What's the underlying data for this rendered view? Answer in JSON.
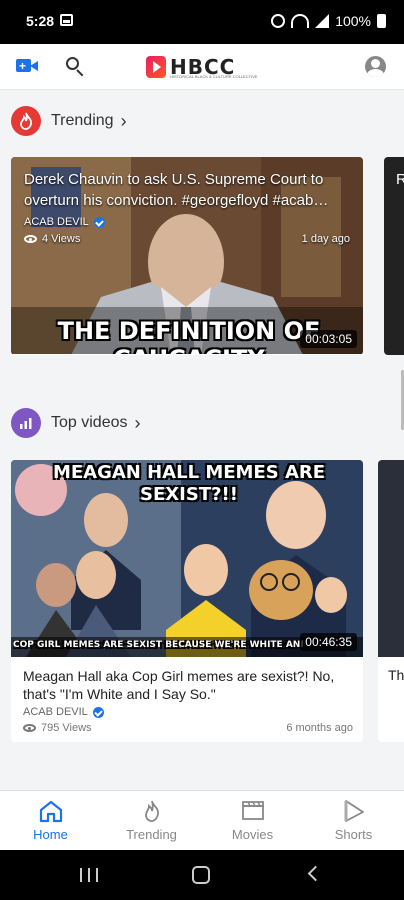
{
  "status_bar": {
    "time": "5:28",
    "battery": "100%"
  },
  "header": {
    "logo_text": "HBCC",
    "logo_tagline": "HISTORICAL BLACK & CULTURE COLLECTIVE"
  },
  "sections": [
    {
      "title": "Trending",
      "icon": "flame-icon",
      "icon_color": "#e53935",
      "card": {
        "title": "Derek Chauvin to ask U.S. Supreme Court to overturn his conviction. #georgefloyd #acab…",
        "channel": "ACAB DEVIL",
        "views": "4 Views",
        "age": "1 day ago",
        "duration": "00:03:05",
        "thumbnail_caption": "THE DEFINITION OF CAUCACITY"
      },
      "peek_text": "R"
    },
    {
      "title": "Top videos",
      "icon": "bar-chart-icon",
      "icon_color": "#7e57c2",
      "card": {
        "title": "Meagan Hall aka Cop Girl memes are sexist?! No, that's \"I'm White and I Say So.\"",
        "channel": "ACAB DEVIL",
        "views": "795 Views",
        "age": "6 months ago",
        "duration": "00:46:35",
        "thumbnail_caption_top": "MEAGAN HALL MEMES ARE SEXIST?!!",
        "thumbnail_caption_bottom": "COP GIRL MEMES ARE SEXIST BECAUSE WE'RE WHITE AND WE SAY SO"
      },
      "peek_text": "Th"
    }
  ],
  "bottom_nav": {
    "items": [
      {
        "label": "Home",
        "icon": "home-icon",
        "active": true
      },
      {
        "label": "Trending",
        "icon": "flame-icon",
        "active": false
      },
      {
        "label": "Movies",
        "icon": "clapperboard-icon",
        "active": false
      },
      {
        "label": "Shorts",
        "icon": "play-icon",
        "active": false
      }
    ]
  },
  "colors": {
    "accent": "#1a73e8",
    "trending": "#e53935",
    "top_videos": "#7e57c2"
  }
}
